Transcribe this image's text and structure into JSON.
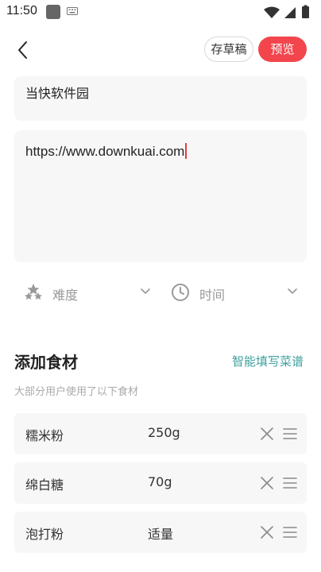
{
  "status_bar": {
    "time": "11:50",
    "icons": [
      "app-square-icon",
      "keyboard-icon",
      "wifi-icon",
      "signal-icon",
      "battery-icon"
    ]
  },
  "top_bar": {
    "back_icon": "back-chevron-icon",
    "draft_label": "存草稿",
    "preview_label": "预览",
    "accent_color": "#f2464c"
  },
  "form": {
    "name_value": "当快软件园",
    "link_value": "https://www.downkuai.com"
  },
  "selectors": {
    "difficulty": {
      "icon": "stars-icon",
      "label": "难度"
    },
    "time": {
      "icon": "clock-icon",
      "label": "时间"
    }
  },
  "ingredients": {
    "title": "添加食材",
    "smart_fill_label": "智能填写菜谱",
    "smart_fill_color": "#3fa0a0",
    "subtitle": "大部分用户使用了以下食材",
    "items": [
      {
        "name": "糯米粉",
        "qty": "250g"
      },
      {
        "name": "绵白糖",
        "qty": "70g"
      },
      {
        "name": "泡打粉",
        "qty": "适量"
      }
    ]
  }
}
